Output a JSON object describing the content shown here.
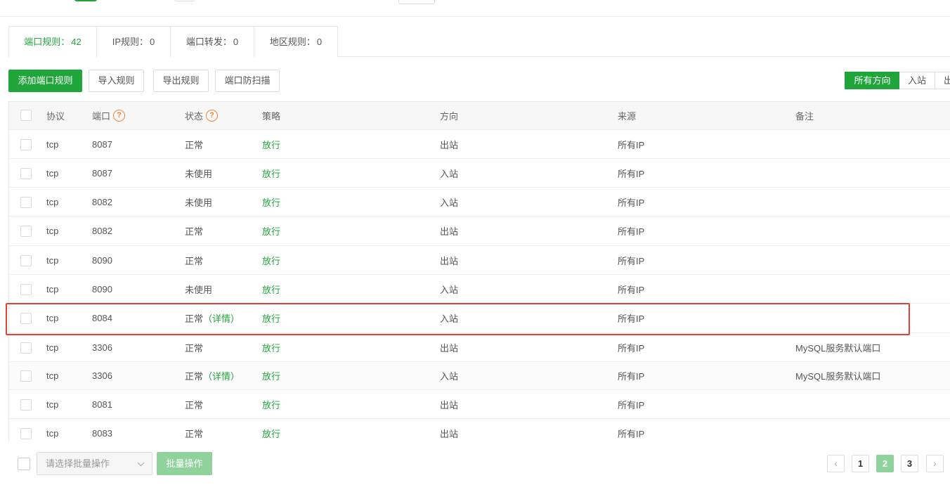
{
  "tabs": [
    {
      "label": "端口规则：",
      "count": "42"
    },
    {
      "label": "IP规则：",
      "count": "0"
    },
    {
      "label": "端口转发：",
      "count": "0"
    },
    {
      "label": "地区规则：",
      "count": "0"
    }
  ],
  "toolbar": {
    "add_label": "添加端口规则",
    "import_label": "导入规则",
    "export_label": "导出规则",
    "scan_label": "端口防扫描"
  },
  "direction_filter": {
    "all": "所有方向",
    "in": "入站",
    "out": "出"
  },
  "table": {
    "headers": {
      "protocol": "协议",
      "port": "端口",
      "status": "状态",
      "policy": "策略",
      "direction": "方向",
      "source": "来源",
      "remark": "备注"
    },
    "help_glyph": "?",
    "rows": [
      {
        "protocol": "tcp",
        "port": "8087",
        "status": "正常",
        "detail": "",
        "policy": "放行",
        "direction": "出站",
        "source": "所有IP",
        "remark": ""
      },
      {
        "protocol": "tcp",
        "port": "8087",
        "status": "未使用",
        "detail": "",
        "policy": "放行",
        "direction": "入站",
        "source": "所有IP",
        "remark": ""
      },
      {
        "protocol": "tcp",
        "port": "8082",
        "status": "未使用",
        "detail": "",
        "policy": "放行",
        "direction": "入站",
        "source": "所有IP",
        "remark": ""
      },
      {
        "protocol": "tcp",
        "port": "8082",
        "status": "正常",
        "detail": "",
        "policy": "放行",
        "direction": "出站",
        "source": "所有IP",
        "remark": ""
      },
      {
        "protocol": "tcp",
        "port": "8090",
        "status": "正常",
        "detail": "",
        "policy": "放行",
        "direction": "出站",
        "source": "所有IP",
        "remark": ""
      },
      {
        "protocol": "tcp",
        "port": "8090",
        "status": "未使用",
        "detail": "",
        "policy": "放行",
        "direction": "入站",
        "source": "所有IP",
        "remark": ""
      },
      {
        "protocol": "tcp",
        "port": "8084",
        "status": "正常",
        "detail": "（详情）",
        "policy": "放行",
        "direction": "入站",
        "source": "所有IP",
        "remark": ""
      },
      {
        "protocol": "tcp",
        "port": "3306",
        "status": "正常",
        "detail": "",
        "policy": "放行",
        "direction": "出站",
        "source": "所有IP",
        "remark": "MySQL服务默认端口"
      },
      {
        "protocol": "tcp",
        "port": "3306",
        "status": "正常",
        "detail": "（详情）",
        "policy": "放行",
        "direction": "入站",
        "source": "所有IP",
        "remark": "MySQL服务默认端口"
      },
      {
        "protocol": "tcp",
        "port": "8081",
        "status": "正常",
        "detail": "",
        "policy": "放行",
        "direction": "出站",
        "source": "所有IP",
        "remark": ""
      },
      {
        "protocol": "tcp",
        "port": "8083",
        "status": "正常",
        "detail": "",
        "policy": "放行",
        "direction": "出站",
        "source": "所有IP",
        "remark": ""
      }
    ]
  },
  "footer": {
    "select_placeholder": "请选择批量操作",
    "batch_label": "批量操作",
    "pages": [
      "1",
      "2",
      "3"
    ],
    "current_page": "2",
    "prev_glyph": "‹",
    "next_glyph": "›"
  },
  "colors": {
    "accent": "#20a53a",
    "highlight": "#e0423b",
    "help_icon": "#f0863a"
  }
}
